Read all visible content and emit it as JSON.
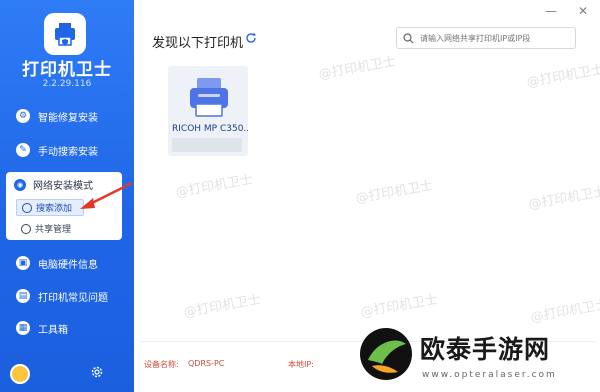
{
  "sidebar": {
    "app_name": "打印机卫士",
    "version": "2.2.29.116",
    "items": [
      {
        "label": "智能修复安装"
      },
      {
        "label": "手动搜索安装"
      },
      {
        "label": "网络安装模式"
      },
      {
        "label": "电脑硬件信息"
      },
      {
        "label": "打印机常见问题"
      },
      {
        "label": "工具箱"
      }
    ],
    "network_sub": [
      {
        "label": "搜索添加",
        "active": true
      },
      {
        "label": "共享管理",
        "active": false
      }
    ]
  },
  "window": {
    "minimize": "—",
    "close": "✕"
  },
  "main": {
    "title": "发现以下打印机",
    "search_placeholder": "请输入网络共享打印机IP或IP段",
    "printers": [
      {
        "name": "RICOH MP C350..."
      }
    ]
  },
  "footer": {
    "device_label": "设备名称:",
    "device_value": "QDRS-PC",
    "ip_label": "本地IP:"
  },
  "watermark": "@打印机卫士",
  "brand": {
    "name": "欧泰手游网",
    "url": "www.opteralaser.com"
  },
  "colors": {
    "sidebar": "#1f66e6",
    "accent": "#2f6fe6",
    "footer_text": "#d24a3a",
    "arrow": "#e0392b"
  }
}
